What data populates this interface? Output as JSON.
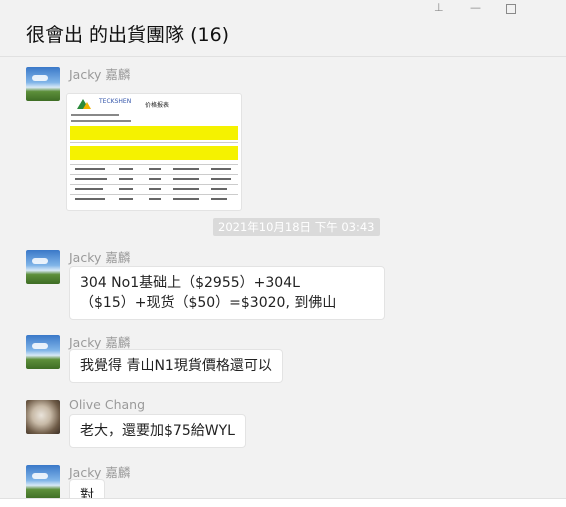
{
  "window": {
    "title": "很會出 的出貨團隊 (16)",
    "pin_icon": "pin-icon",
    "minimize_icon": "minimize-icon",
    "maximize_icon": "maximize-icon"
  },
  "messages": [
    {
      "sender": "Jacky 嘉麟",
      "avatar": "landscape-sky",
      "type": "image"
    },
    {
      "type": "timestamp",
      "text": "2021年10月18日 下午 03:43"
    },
    {
      "sender": "Jacky 嘉麟",
      "avatar": "landscape-sky",
      "type": "text",
      "text": "304 No1基础上（$2955）+304L（$15）+现货（$50）=$3020, 到佛山"
    },
    {
      "sender": "Jacky 嘉麟",
      "avatar": "landscape-sky",
      "type": "text",
      "text": "我覺得 青山N1現貨價格還可以"
    },
    {
      "sender": "Olive Chang",
      "avatar": "cat-photo",
      "type": "text",
      "text": "老大，還要加$75給WYL"
    },
    {
      "sender": "Jacky 嘉麟",
      "avatar": "landscape-sky",
      "type": "text",
      "text": "對"
    }
  ],
  "image_card": {
    "logo_text": "TECKSHEN",
    "doc_title": "价格报表"
  },
  "colors": {
    "background": "#f2f2f2",
    "bubble": "#ffffff",
    "sender": "#9a9a9a",
    "timestamp_bg": "#dadada",
    "highlight": "#f5f200"
  }
}
